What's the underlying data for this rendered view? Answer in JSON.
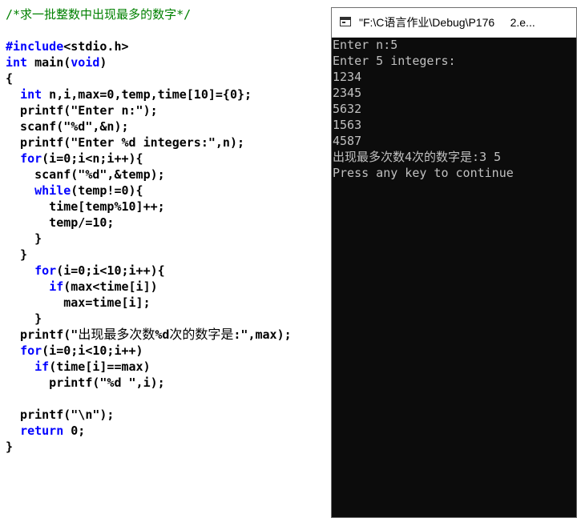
{
  "editor": {
    "lines": [
      [
        {
          "t": "/*求一批整数中出现最多的数字*/",
          "c": "cm"
        }
      ],
      [
        {
          "t": "",
          "c": ""
        }
      ],
      [
        {
          "t": "#include",
          "c": "kw"
        },
        {
          "t": "<stdio.h>",
          "c": ""
        }
      ],
      [
        {
          "t": "int",
          "c": "kw"
        },
        {
          "t": " main(",
          "c": ""
        },
        {
          "t": "void",
          "c": "kw"
        },
        {
          "t": ")",
          "c": ""
        }
      ],
      [
        {
          "t": "{",
          "c": ""
        }
      ],
      [
        {
          "t": "  ",
          "c": ""
        },
        {
          "t": "int",
          "c": "kw"
        },
        {
          "t": " n,i,max=0,temp,time[10]={0};",
          "c": ""
        }
      ],
      [
        {
          "t": "  printf(\"Enter n:\");",
          "c": ""
        }
      ],
      [
        {
          "t": "  scanf(\"%d\",&n);",
          "c": ""
        }
      ],
      [
        {
          "t": "  printf(\"Enter %d integers:\",n);",
          "c": ""
        }
      ],
      [
        {
          "t": "  ",
          "c": ""
        },
        {
          "t": "for",
          "c": "kw"
        },
        {
          "t": "(i=0;i<n;i++){",
          "c": ""
        }
      ],
      [
        {
          "t": "    scanf(\"%d\",&temp);",
          "c": ""
        }
      ],
      [
        {
          "t": "    ",
          "c": ""
        },
        {
          "t": "while",
          "c": "kw"
        },
        {
          "t": "(temp!=0){",
          "c": ""
        }
      ],
      [
        {
          "t": "      time[temp%10]++;",
          "c": ""
        }
      ],
      [
        {
          "t": "      temp/=10;",
          "c": ""
        }
      ],
      [
        {
          "t": "    }",
          "c": ""
        }
      ],
      [
        {
          "t": "  }",
          "c": ""
        }
      ],
      [
        {
          "t": "    ",
          "c": ""
        },
        {
          "t": "for",
          "c": "kw"
        },
        {
          "t": "(i=0;i<10;i++){",
          "c": ""
        }
      ],
      [
        {
          "t": "      ",
          "c": ""
        },
        {
          "t": "if",
          "c": "kw"
        },
        {
          "t": "(max<time[i])",
          "c": ""
        }
      ],
      [
        {
          "t": "        max=time[i];",
          "c": ""
        }
      ],
      [
        {
          "t": "    }",
          "c": ""
        }
      ],
      [
        {
          "t": "  printf(\"",
          "c": ""
        },
        {
          "t": "出现最多次数",
          "c": "cjk"
        },
        {
          "t": "%d",
          "c": ""
        },
        {
          "t": "次的数字是",
          "c": "cjk"
        },
        {
          "t": ":\",max);",
          "c": ""
        }
      ],
      [
        {
          "t": "  ",
          "c": ""
        },
        {
          "t": "for",
          "c": "kw"
        },
        {
          "t": "(i=0;i<10;i++)",
          "c": ""
        }
      ],
      [
        {
          "t": "    ",
          "c": ""
        },
        {
          "t": "if",
          "c": "kw"
        },
        {
          "t": "(time[i]==max)",
          "c": ""
        }
      ],
      [
        {
          "t": "      printf(\"%d \",i);",
          "c": ""
        }
      ],
      [
        {
          "t": "",
          "c": ""
        }
      ],
      [
        {
          "t": "  printf(\"\\n\");",
          "c": ""
        }
      ],
      [
        {
          "t": "  ",
          "c": ""
        },
        {
          "t": "return",
          "c": "kw"
        },
        {
          "t": " 0;",
          "c": ""
        }
      ],
      [
        {
          "t": "}",
          "c": ""
        }
      ]
    ]
  },
  "console": {
    "title": "\"F:\\C语言作业\\Debug\\P176     2.e...",
    "output": [
      "Enter n:5",
      "Enter 5 integers:",
      "1234",
      "2345",
      "5632",
      "1563",
      "4587",
      "出现最多次数4次的数字是:3 5",
      "Press any key to continue"
    ]
  },
  "colors": {
    "keyword": "#0000ff",
    "comment": "#008000",
    "console_bg": "#0c0c0c",
    "console_text": "#c0c0c0"
  },
  "icons": {
    "console_app": "console-window-icon"
  }
}
